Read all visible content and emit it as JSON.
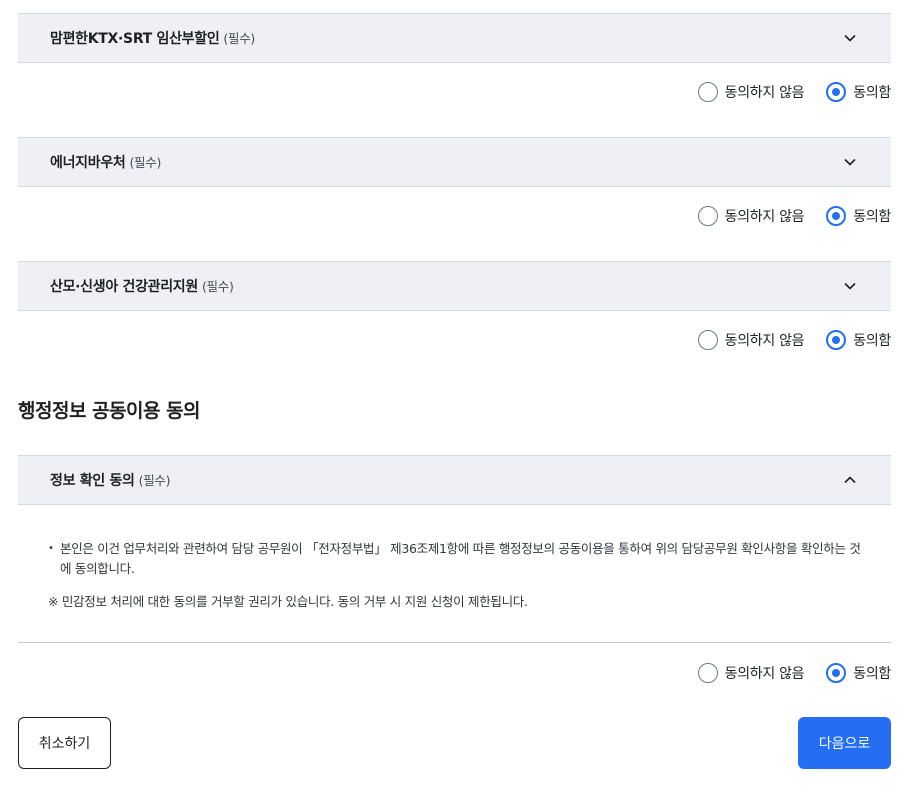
{
  "accordions": [
    {
      "title": "맘편한KTX·SRT 임산부할인",
      "required": "(필수)",
      "expanded": false,
      "icon": "chevron-down-icon"
    },
    {
      "title": "에너지바우처",
      "required": "(필수)",
      "expanded": false,
      "icon": "chevron-down-icon"
    },
    {
      "title": "산모·신생아 건강관리지원",
      "required": "(필수)",
      "expanded": false,
      "icon": "chevron-down-icon"
    }
  ],
  "consent": {
    "disagree_label": "동의하지 않음",
    "agree_label": "동의함",
    "selected": "agree"
  },
  "section": {
    "title": "행정정보 공동이용 동의",
    "accordion": {
      "title": "정보 확인 동의",
      "required": "(필수)",
      "expanded": true,
      "icon": "chevron-up-icon"
    },
    "body_bullet": "본인은 이건 업무처리와 관련하여 담당 공무원이 「전자정부법」 제36조제1항에 따른 행정정보의 공동이용을 통하여 위의 담당공무원 확인사항을 확인하는 것에 동의합니다.",
    "notice": "※ 민감정보 처리에 대한 동의를 거부할 권리가 있습니다. 동의 거부 시 지원 신청이 제한됩니다."
  },
  "footer": {
    "cancel_label": "취소하기",
    "next_label": "다음으로"
  },
  "colors": {
    "accent": "#256ef4",
    "header_bg": "#eef0f5",
    "text": "#1e2124"
  }
}
